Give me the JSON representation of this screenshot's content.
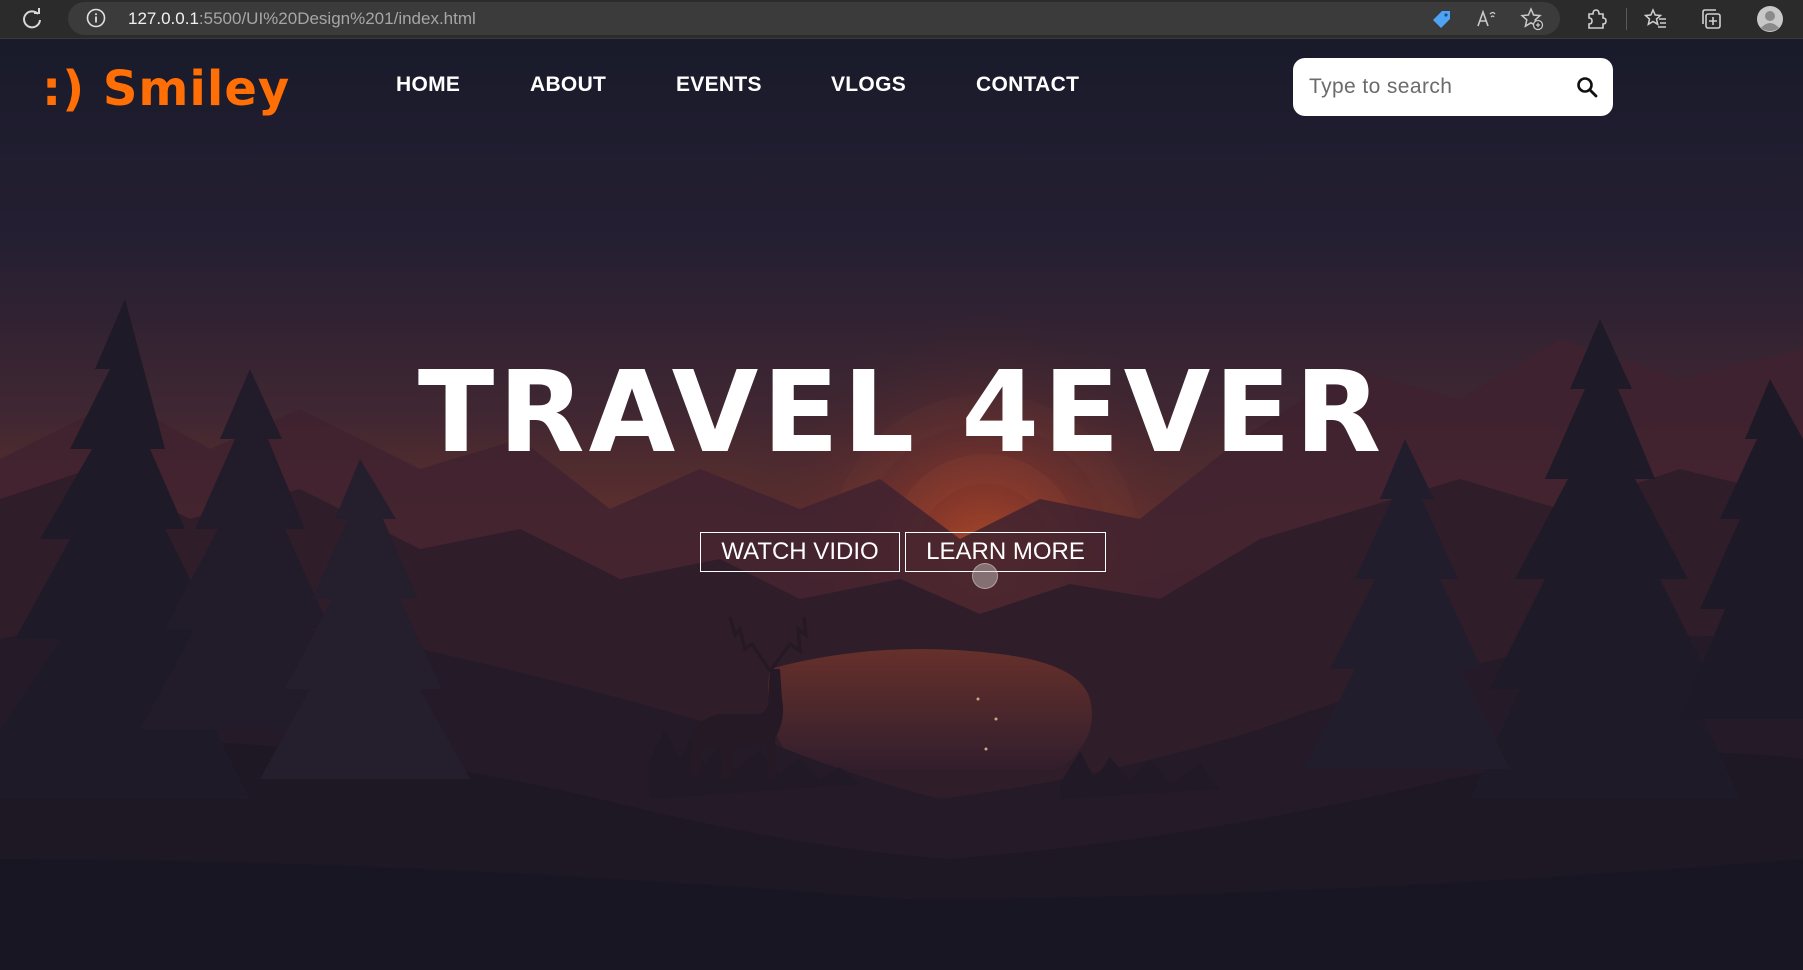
{
  "browser": {
    "url_host": "127.0.0.1",
    "url_path": ":5500/UI%20Design%201/index.html",
    "icons": [
      "reload-icon",
      "site-info-icon",
      "coupon-tag-icon",
      "read-aloud-icon",
      "add-favorite-icon",
      "extensions-icon",
      "favorites-icon",
      "collections-icon",
      "profile-icon"
    ]
  },
  "header": {
    "logo": ":) Smiley",
    "nav": [
      "HOME",
      "ABOUT",
      "EVENTS",
      "VLOGS",
      "CONTACT"
    ],
    "search": {
      "placeholder": "Type to search",
      "value": ""
    }
  },
  "hero": {
    "title": "TRAVEL 4EVER",
    "buttons": [
      "WATCH VIDIO",
      "LEARN MORE"
    ]
  },
  "colors": {
    "brand_orange": "#ff6f06",
    "sky_top": "#1b1c2b",
    "sunset_glow": "#b5512a",
    "text": "#ffffff"
  }
}
